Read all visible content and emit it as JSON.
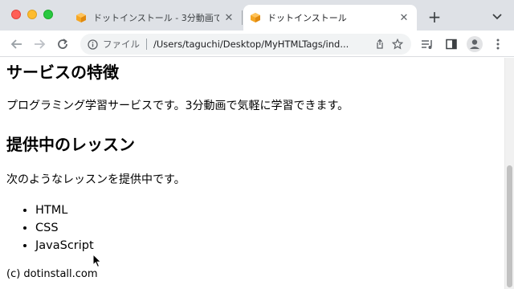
{
  "browser": {
    "tabs": [
      {
        "title": "ドットインストール - 3分動画でマ",
        "active": false,
        "favicon": "dotinstall-cube-icon"
      },
      {
        "title": "ドットインストール",
        "active": true,
        "favicon": "dotinstall-cube-icon"
      }
    ],
    "new_tab_icon": "plus-icon",
    "tab_search_icon": "chevron-down-icon",
    "address": {
      "scheme_label": "ファイル",
      "url": "/Users/taguchi/Desktop/MyHTMLTags/ind..."
    },
    "icons": {
      "back": "arrow-left-icon",
      "forward": "arrow-right-icon",
      "reload": "reload-icon",
      "info": "info-icon",
      "share": "share-icon",
      "bookmark": "star-icon",
      "playlist": "playlist-icon",
      "side_panel": "side-panel-icon",
      "profile": "profile-icon",
      "menu": "kebab-menu-icon"
    },
    "colors": {
      "tabstrip_bg": "#dee1e6",
      "favicon_orange": "#f5a623"
    }
  },
  "page": {
    "features_heading": "サービスの特徴",
    "features_text": "プログラミング学習サービスです。3分動画で気軽に学習できます。",
    "lessons_heading": "提供中のレッスン",
    "lessons_text": "次のようなレッスンを提供中です。",
    "lessons": [
      "HTML",
      "CSS",
      "JavaScript"
    ],
    "footer": "(c) dotinstall.com"
  }
}
